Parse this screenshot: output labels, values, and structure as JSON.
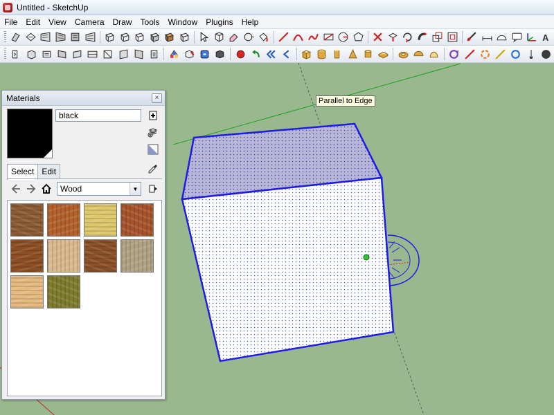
{
  "window": {
    "title": "Untitled - SketchUp"
  },
  "menu": [
    "File",
    "Edit",
    "View",
    "Camera",
    "Draw",
    "Tools",
    "Window",
    "Plugins",
    "Help"
  ],
  "viewport": {
    "tooltip": "Parallel to Edge"
  },
  "materials": {
    "title": "Materials",
    "close_glyph": "×",
    "material_name": "black",
    "swatch_color": "#000000",
    "tabs": [
      "Select",
      "Edit"
    ],
    "active_tab": "Select",
    "library": "Wood",
    "tiles": [
      {
        "name": "wood-tile-1",
        "color": "#8a5a33"
      },
      {
        "name": "wood-tile-2",
        "color": "#b3602b"
      },
      {
        "name": "wood-tile-3",
        "color": "#dcc76a"
      },
      {
        "name": "wood-tile-4",
        "color": "#a7532a"
      },
      {
        "name": "wood-tile-5",
        "color": "#8c4d22"
      },
      {
        "name": "wood-tile-6",
        "color": "#dab98c"
      },
      {
        "name": "wood-tile-7",
        "color": "#8a4f26"
      },
      {
        "name": "wood-tile-8",
        "color": "#b1a283"
      },
      {
        "name": "wood-tile-9",
        "color": "#e5b97e"
      },
      {
        "name": "wood-tile-10",
        "color": "#7e7b2d"
      }
    ]
  },
  "colors": {
    "viewport_bg": "#9ab88f",
    "edge_selected": "#1c1ce6",
    "axis_green": "#1aa31a",
    "axis_red": "#cc2222",
    "protractor": "#1c1ce6"
  }
}
